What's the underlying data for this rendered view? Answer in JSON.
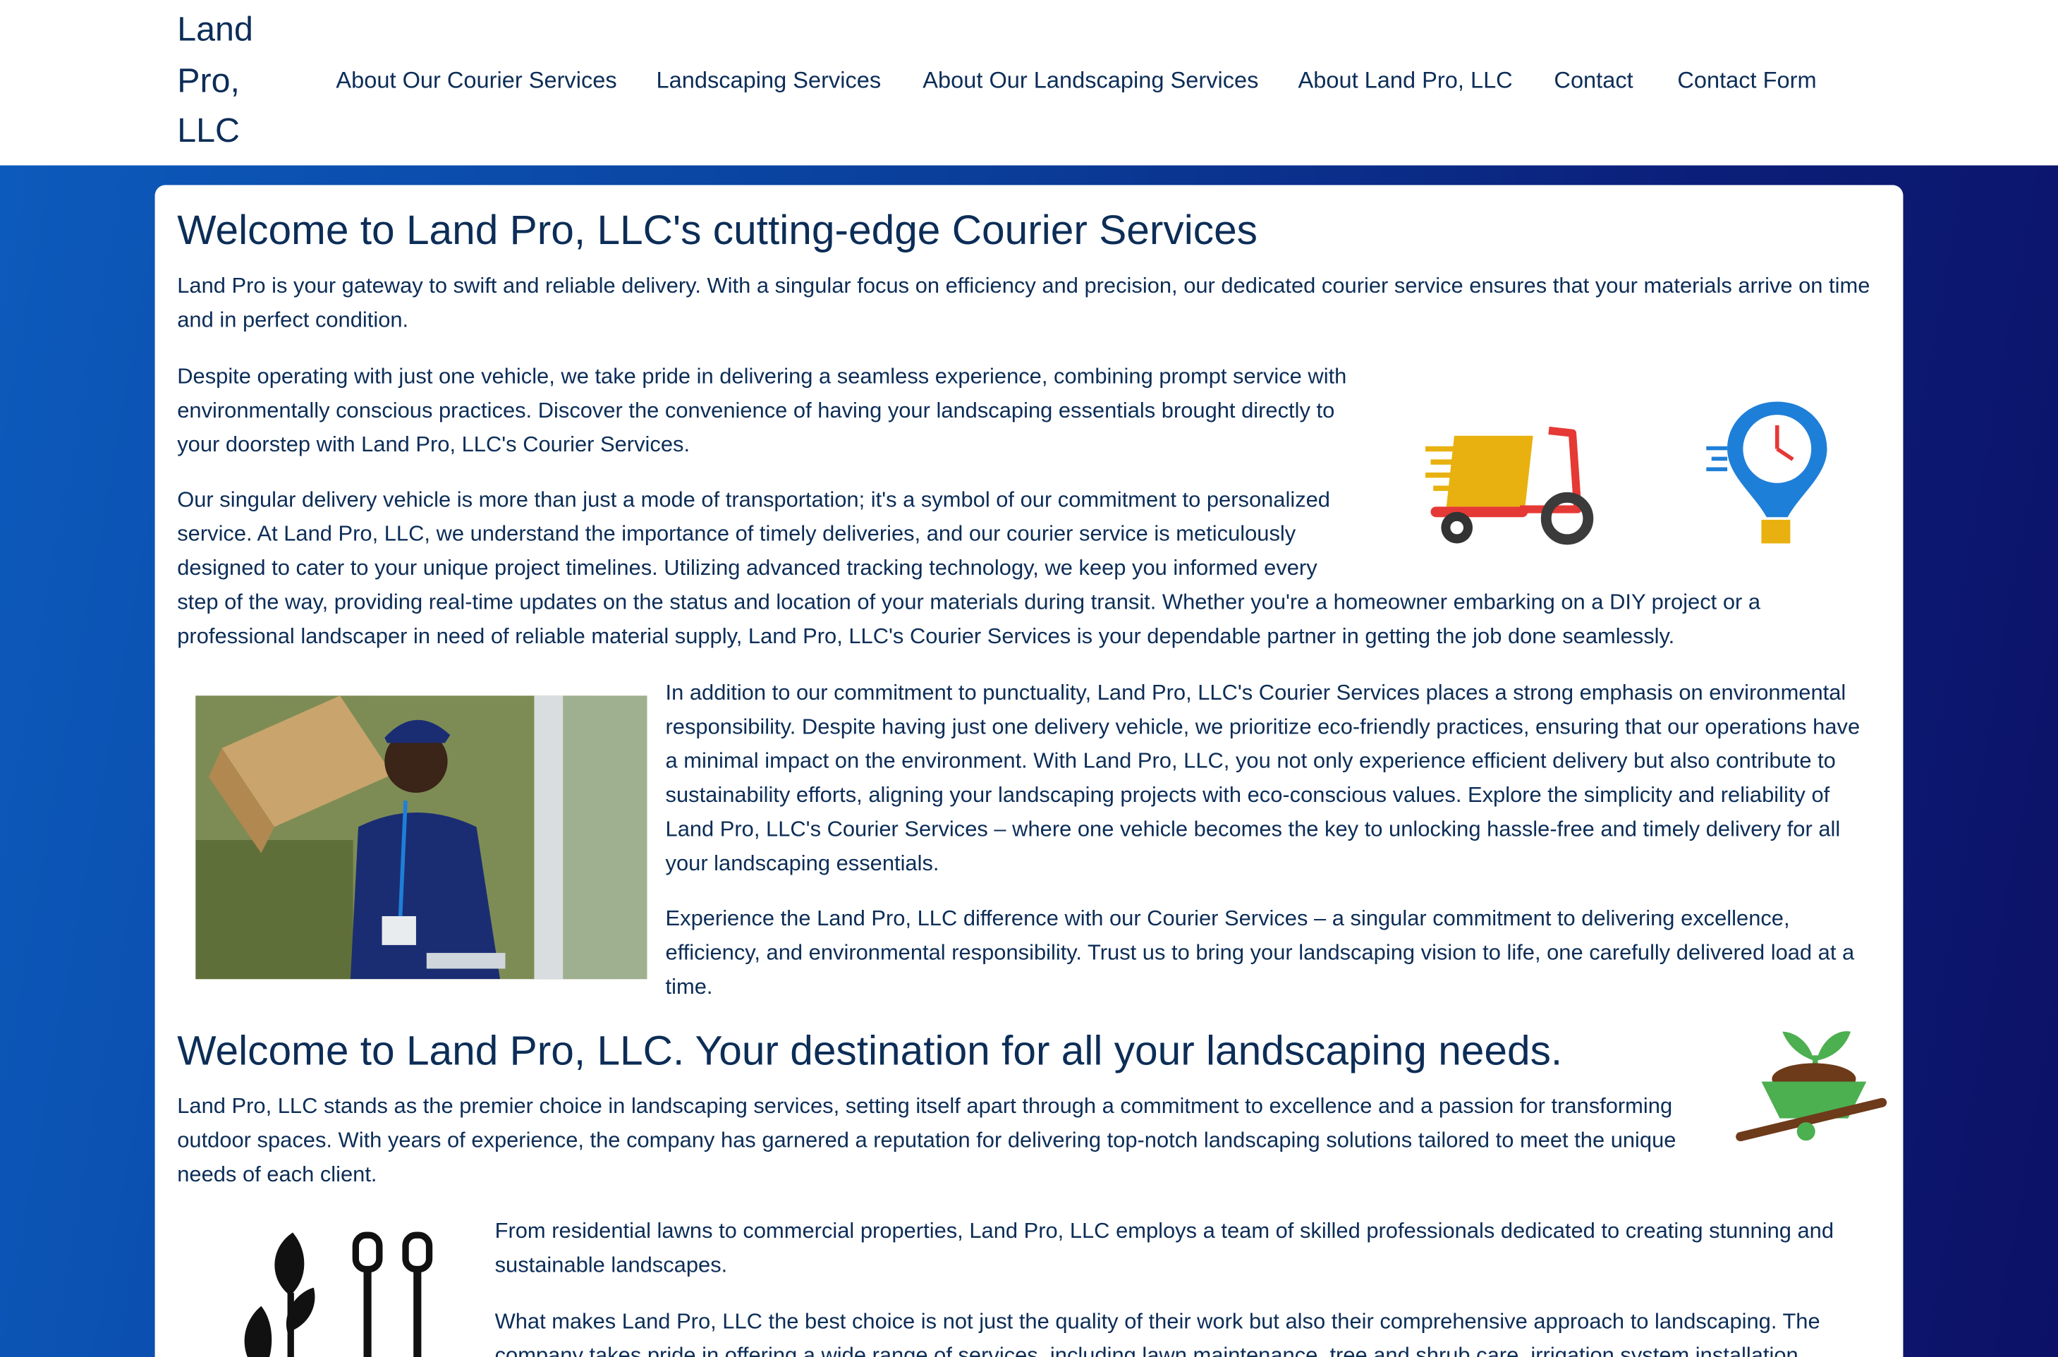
{
  "nav": {
    "brand": "Land Pro, LLC",
    "links": [
      "About Our Courier Services",
      "Landscaping Services",
      "About Our Landscaping Services",
      "About Land Pro, LLC",
      "Contact",
      "Contact Form"
    ]
  },
  "courier": {
    "heading": "Welcome to Land Pro, LLC's cutting-edge Courier Services",
    "p1": "Land Pro is your gateway to swift and reliable delivery. With a singular focus on efficiency and precision, our dedicated courier service ensures that your materials arrive on time and in perfect condition.",
    "p2": "Despite operating with just one vehicle, we take pride in delivering a seamless experience, combining prompt service with environmentally conscious practices. Discover the convenience of having your landscaping essentials brought directly to your doorstep with Land Pro, LLC's Courier Services.",
    "p3": "Our singular delivery vehicle is more than just a mode of transportation; it's a symbol of our commitment to personalized service. At Land Pro, LLC, we understand the importance of timely deliveries, and our courier service is meticulously designed to cater to your unique project timelines. Utilizing advanced tracking technology, we keep you informed every step of the way, providing real-time updates on the status and location of your materials during transit. Whether you're a homeowner embarking on a DIY project or a professional landscaper in need of reliable material supply, Land Pro, LLC's Courier Services is your dependable partner in getting the job done seamlessly.",
    "p4": "In addition to our commitment to punctuality, Land Pro, LLC's Courier Services places a strong emphasis on environmental responsibility. Despite having just one delivery vehicle, we prioritize eco-friendly practices, ensuring that our operations have a minimal impact on the environment. With Land Pro, LLC, you not only experience efficient delivery but also contribute to sustainability efforts, aligning your landscaping projects with eco-conscious values. Explore the simplicity and reliability of Land Pro, LLC's Courier Services – where one vehicle becomes the key to unlocking hassle-free and timely delivery for all your landscaping essentials.",
    "p5": "Experience the Land Pro, LLC difference with our Courier Services – a singular commitment to delivering excellence, efficiency, and environmental responsibility. Trust us to bring your landscaping vision to life, one carefully delivered load at a time."
  },
  "landscaping": {
    "heading": "Welcome to Land Pro, LLC. Your destination for all your landscaping needs.",
    "p1": "Land Pro, LLC stands as the premier choice in landscaping services, setting itself apart through a commitment to excellence and a passion for transforming outdoor spaces. With years of experience, the company has garnered a reputation for delivering top-notch landscaping solutions tailored to meet the unique needs of each client.",
    "p2": "From residential lawns to commercial properties, Land Pro, LLC employs a team of skilled professionals dedicated to creating stunning and sustainable landscapes.",
    "p3": "What makes Land Pro, LLC the best choice is not just the quality of their work but also their comprehensive approach to landscaping. The company takes pride in offering a wide range of services, including lawn maintenance, tree and shrub care, irrigation system installation"
  },
  "colors": {
    "text": "#0c2d57",
    "scooter_yellow": "#e8b10f",
    "scooter_red": "#e53935",
    "pin_blue": "#1e7fd8",
    "plant_green": "#4caf50",
    "soil_brown": "#6d3a1a"
  }
}
